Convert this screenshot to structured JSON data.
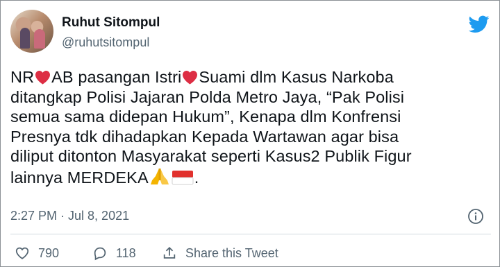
{
  "user": {
    "display_name": "Ruhut Sitompul",
    "handle": "@ruhutsitompul"
  },
  "tweet": {
    "segments": [
      [
        "NR",
        "heart",
        "AB pasangan Istri",
        "heart",
        "Suami dlm Kasus Narkoba"
      ],
      [
        "ditangkap Polisi Jajaran Polda Metro Jaya, “Pak Polisi"
      ],
      [
        "semua sama didepan Hukum”, Kenapa   dlm Konfrensi"
      ],
      [
        "Presnya tdk dihadapkan Kepada Wartawan agar bisa"
      ],
      [
        "diliput ditonton Masyarakat seperti Kasus2 Publik Figur"
      ],
      [
        "lainnya MERDEKA",
        "pray",
        "flag-id",
        "."
      ]
    ],
    "timestamp": "2:27 PM · Jul 8, 2021"
  },
  "actions": {
    "likes": "790",
    "replies": "118",
    "share_label": "Share this Tweet"
  },
  "icons": {
    "brand": "twitter-bird-icon",
    "heart_emoji": "red-heart-emoji",
    "pray_emoji": "folded-hands-emoji",
    "flag_emoji": "indonesia-flag-emoji"
  },
  "colors": {
    "twitter_blue": "#1d9bf0",
    "text_primary": "#0f1419",
    "text_secondary": "#536471",
    "heart_red": "#e0245e"
  }
}
